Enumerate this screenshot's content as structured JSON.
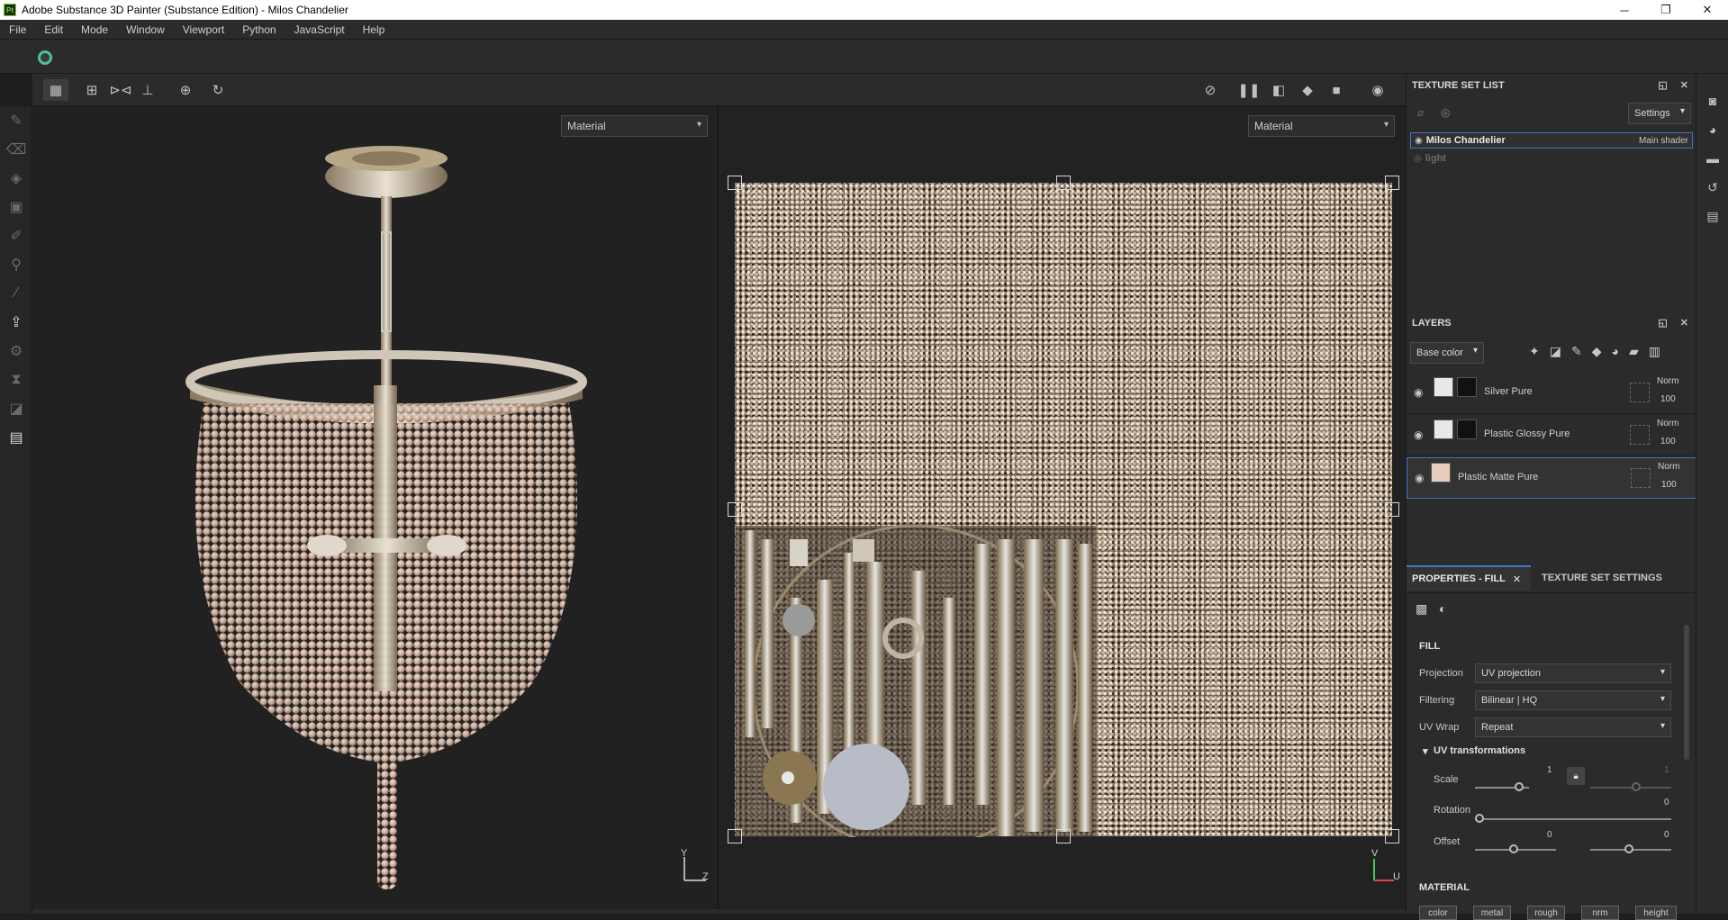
{
  "window": {
    "title": "Adobe Substance 3D Painter (Substance Edition) - Milos Chandelier",
    "app_badge": "Pt",
    "controls": [
      "─",
      "❐",
      "✕"
    ]
  },
  "menu": [
    "File",
    "Edit",
    "Mode",
    "Window",
    "Viewport",
    "Python",
    "JavaScript",
    "Help"
  ],
  "viewport_3d": {
    "mode": "Material",
    "axis_y": "Y",
    "axis_z": "Z"
  },
  "viewport_2d": {
    "mode": "Material",
    "axis_v": "V",
    "axis_u": "U"
  },
  "texture_set_list": {
    "title": "TEXTURE SET LIST",
    "settings_label": "Settings",
    "items": [
      {
        "name": "Milos Chandelier",
        "shader": "Main shader",
        "selected": true
      },
      {
        "name": "light",
        "shader": "",
        "selected": false
      }
    ]
  },
  "layers": {
    "title": "LAYERS",
    "channel": "Base color",
    "items": [
      {
        "name": "Silver Pure",
        "blend": "Norm",
        "opacity": "100",
        "selected": false
      },
      {
        "name": "Plastic Glossy Pure",
        "blend": "Norm",
        "opacity": "100",
        "selected": false
      },
      {
        "name": "Plastic Matte Pure",
        "blend": "Norm",
        "opacity": "100",
        "selected": true
      }
    ]
  },
  "properties": {
    "tab_fill": "PROPERTIES - FILL",
    "tab_texture_settings": "TEXTURE SET SETTINGS",
    "section_fill": "FILL",
    "projection_label": "Projection",
    "projection_value": "UV projection",
    "filtering_label": "Filtering",
    "filtering_value": "Bilinear | HQ",
    "uvwrap_label": "UV Wrap",
    "uvwrap_value": "Repeat",
    "uv_transformations": "UV transformations",
    "scale_label": "Scale",
    "scale_value": "1",
    "scale_value_2": "1",
    "rotation_label": "Rotation",
    "rotation_value": "0",
    "offset_label": "Offset",
    "offset_value_1": "0",
    "offset_value_2": "0",
    "section_material": "MATERIAL",
    "channels": [
      "color",
      "metal",
      "rough",
      "nrm",
      "height"
    ]
  }
}
